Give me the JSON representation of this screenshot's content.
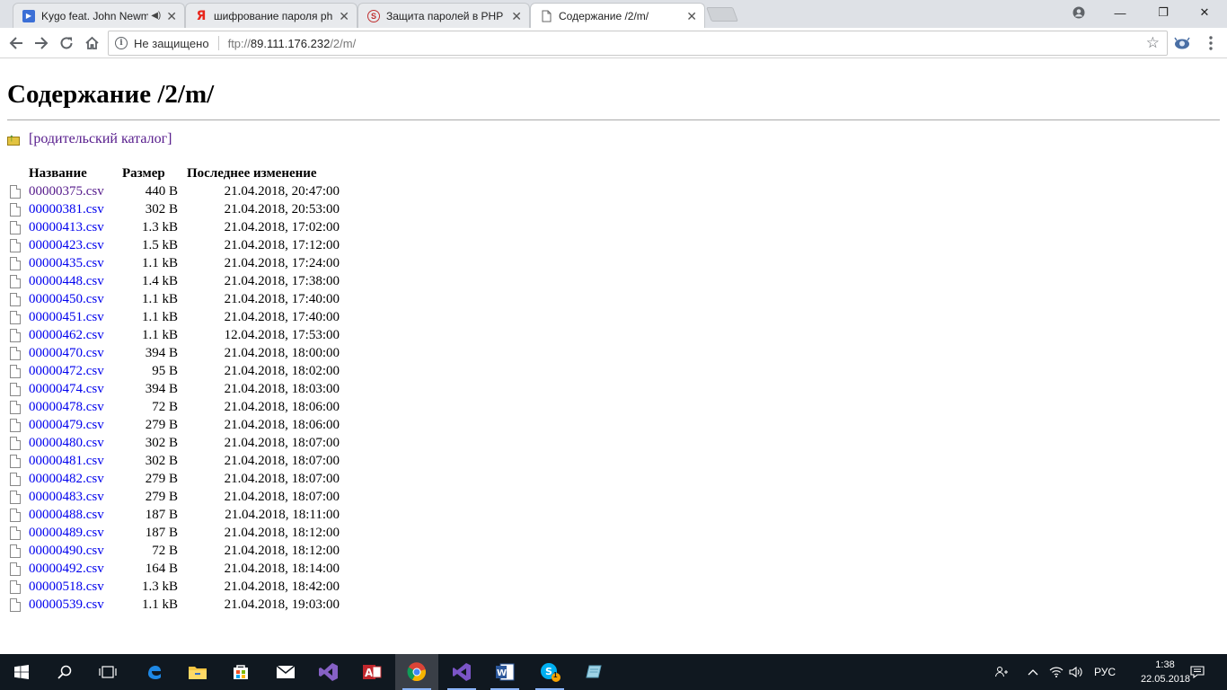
{
  "browser": {
    "tabs": [
      {
        "title": "Kygo feat. John Newm",
        "favicon": "play-icon",
        "audio": true
      },
      {
        "title": "шифрование пароля php",
        "favicon": "yandex-icon"
      },
      {
        "title": "Защита паролей в PHP |",
        "favicon": "s-icon"
      },
      {
        "title": "Содержание /2/m/",
        "favicon": "page-icon",
        "active": true
      }
    ],
    "omnibox": {
      "security_label": "Не защищено",
      "url_scheme": "ftp://",
      "url_host": "89.111.176.232",
      "url_path": "/2/m/"
    }
  },
  "page": {
    "title": "Содержание /2/m/",
    "parent_link": "[родительский каталог]",
    "columns": {
      "name": "Название",
      "size": "Размер",
      "modified": "Последнее изменение"
    },
    "files": [
      {
        "name": "00000375.csv",
        "size": "440 B",
        "modified": "21.04.2018, 20:47:00",
        "visited": true
      },
      {
        "name": "00000381.csv",
        "size": "302 B",
        "modified": "21.04.2018, 20:53:00"
      },
      {
        "name": "00000413.csv",
        "size": "1.3 kB",
        "modified": "21.04.2018, 17:02:00"
      },
      {
        "name": "00000423.csv",
        "size": "1.5 kB",
        "modified": "21.04.2018, 17:12:00"
      },
      {
        "name": "00000435.csv",
        "size": "1.1 kB",
        "modified": "21.04.2018, 17:24:00"
      },
      {
        "name": "00000448.csv",
        "size": "1.4 kB",
        "modified": "21.04.2018, 17:38:00"
      },
      {
        "name": "00000450.csv",
        "size": "1.1 kB",
        "modified": "21.04.2018, 17:40:00"
      },
      {
        "name": "00000451.csv",
        "size": "1.1 kB",
        "modified": "21.04.2018, 17:40:00"
      },
      {
        "name": "00000462.csv",
        "size": "1.1 kB",
        "modified": "12.04.2018, 17:53:00"
      },
      {
        "name": "00000470.csv",
        "size": "394 B",
        "modified": "21.04.2018, 18:00:00"
      },
      {
        "name": "00000472.csv",
        "size": "95 B",
        "modified": "21.04.2018, 18:02:00"
      },
      {
        "name": "00000474.csv",
        "size": "394 B",
        "modified": "21.04.2018, 18:03:00"
      },
      {
        "name": "00000478.csv",
        "size": "72 B",
        "modified": "21.04.2018, 18:06:00"
      },
      {
        "name": "00000479.csv",
        "size": "279 B",
        "modified": "21.04.2018, 18:06:00"
      },
      {
        "name": "00000480.csv",
        "size": "302 B",
        "modified": "21.04.2018, 18:07:00"
      },
      {
        "name": "00000481.csv",
        "size": "302 B",
        "modified": "21.04.2018, 18:07:00"
      },
      {
        "name": "00000482.csv",
        "size": "279 B",
        "modified": "21.04.2018, 18:07:00"
      },
      {
        "name": "00000483.csv",
        "size": "279 B",
        "modified": "21.04.2018, 18:07:00"
      },
      {
        "name": "00000488.csv",
        "size": "187 B",
        "modified": "21.04.2018, 18:11:00"
      },
      {
        "name": "00000489.csv",
        "size": "187 B",
        "modified": "21.04.2018, 18:12:00"
      },
      {
        "name": "00000490.csv",
        "size": "72 B",
        "modified": "21.04.2018, 18:12:00"
      },
      {
        "name": "00000492.csv",
        "size": "164 B",
        "modified": "21.04.2018, 18:14:00"
      },
      {
        "name": "00000518.csv",
        "size": "1.3 kB",
        "modified": "21.04.2018, 18:42:00"
      },
      {
        "name": "00000539.csv",
        "size": "1.1 kB",
        "modified": "21.04.2018, 19:03:00"
      }
    ]
  },
  "taskbar": {
    "language": "РУС",
    "time": "1:38",
    "date": "22.05.2018",
    "skype_badge": "1"
  },
  "colors": {
    "link": "#0000ee",
    "visited_link": "#551a8b",
    "taskbar": "#101820",
    "tabstrip": "#dee1e6"
  }
}
